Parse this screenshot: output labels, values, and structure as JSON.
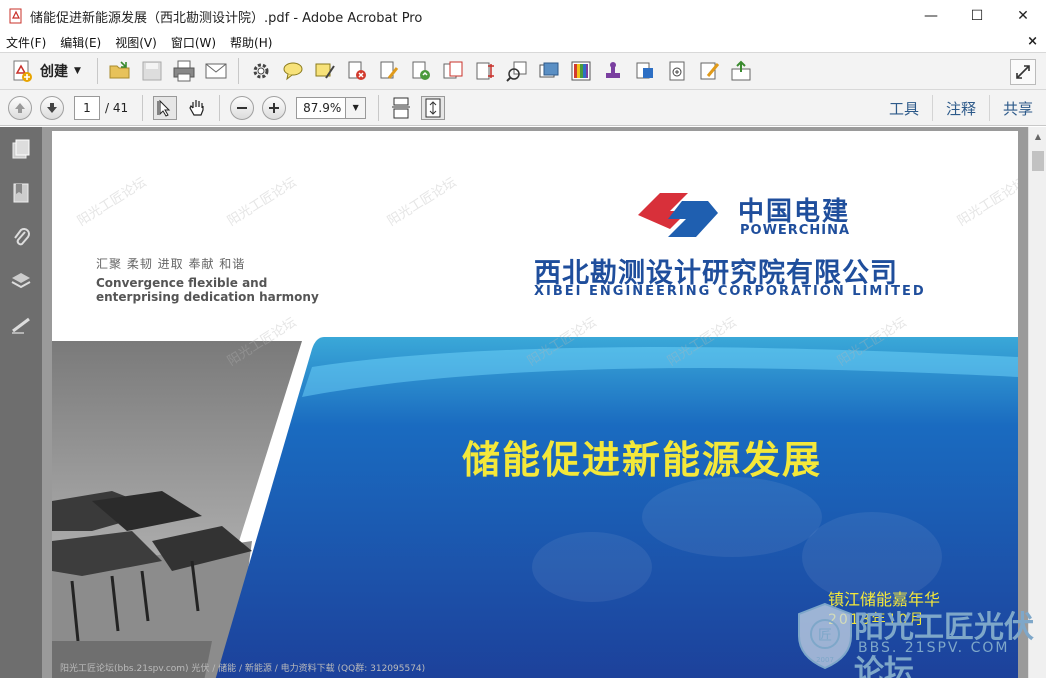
{
  "window": {
    "title": "储能促进新能源发展（西北勘测设计院）.pdf - Adobe Acrobat Pro",
    "minimize": "—",
    "maximize": "☐",
    "close": "✕"
  },
  "menu": {
    "items": [
      "文件(F)",
      "编辑(E)",
      "视图(V)",
      "窗口(W)",
      "帮助(H)"
    ],
    "doc_close": "×"
  },
  "toolbar": {
    "create_label": "创建",
    "icons": [
      "open-folder-icon",
      "save-icon",
      "print-icon",
      "email-icon",
      "settings-icon",
      "comment-icon",
      "highlight-icon",
      "delete-pages-icon",
      "edit-document-icon",
      "rotate-icon",
      "extract-pages-icon",
      "crop-icon",
      "search-compare-icon",
      "combine-icon",
      "color-bars-icon",
      "stamp-icon",
      "protect-icon",
      "add-file-icon",
      "sign-icon",
      "export-icon"
    ]
  },
  "nav": {
    "page_current": "1",
    "page_total": "/ 41",
    "zoom": "87.9%",
    "tabs": [
      "工具",
      "注释",
      "共享"
    ]
  },
  "sidebar": {
    "icons": [
      "pages-icon",
      "bookmark-icon",
      "attachment-icon",
      "layers-icon",
      "signature-icon"
    ]
  },
  "slide": {
    "slogan_cn": "汇聚 柔韧 进取 奉献 和谐",
    "slogan_en_1": "Convergence flexible and",
    "slogan_en_2": "enterprising dedication harmony",
    "brand_cn": "中国电建",
    "brand_en": "POWERCHINA",
    "corp_cn": "西北勘测设计研究院有限公司",
    "corp_en": "XIBEI ENGINEERING CORPORATION LIMITED",
    "main_title": "储能促进新能源发展",
    "event": "镇江储能嘉年华",
    "date": "2018年10月",
    "footer": "阳光工匠论坛(bbs.21spv.com)    光伏 / 储能 / 新能源 / 电力资料下载    (QQ群: 312095574)",
    "watermark": "阳光工匠论坛"
  },
  "forum_logo": {
    "cn": "阳光工匠光伏论坛",
    "url": "BBS. 21SPV. COM",
    "year": "2007"
  }
}
